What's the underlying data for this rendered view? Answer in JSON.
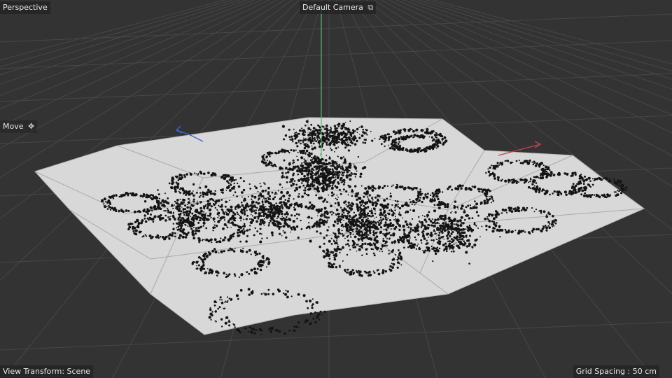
{
  "viewport": {
    "projection_label": "Perspective",
    "camera_label": "Default Camera",
    "camera_icon": "camera-link-icon",
    "tool_label": "Move",
    "tool_icon": "move-arrows-icon",
    "view_transform_label": "View Transform: Scene",
    "grid_spacing_label": "Grid Spacing : 50 cm"
  },
  "colors": {
    "background": "#333333",
    "grid": "#464646",
    "mesh": "#d8d8d8",
    "points": "#141414",
    "axis_y": "#2fd06a",
    "axis_x": "#c0404a",
    "axis_z": "#3f66c8"
  }
}
